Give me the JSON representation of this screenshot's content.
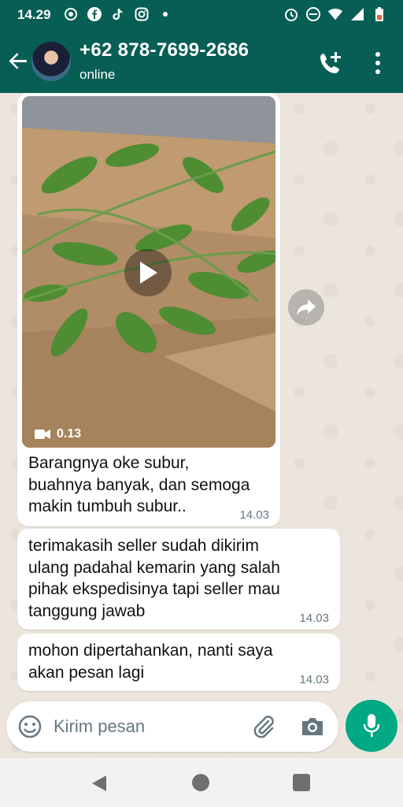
{
  "status_bar": {
    "time": "14.29",
    "left_icons": [
      "whatsapp-status-icon",
      "facebook-icon",
      "tiktok-icon",
      "instagram-icon",
      "dot-icon"
    ],
    "right_icons": [
      "alarm-icon",
      "do-not-disturb-icon",
      "wifi-icon",
      "signal-icon",
      "battery-icon"
    ]
  },
  "header": {
    "contact_name": "+62 878-7699-2686",
    "status": "online"
  },
  "messages": [
    {
      "type": "video",
      "duration": "0.13",
      "caption": "Barangnya oke subur,\nbuahnya banyak, dan semoga\nmakin tumbuh subur..",
      "time": "14.03"
    },
    {
      "type": "text",
      "text": "terimakasih seller sudah dikirim\nulang padahal kemarin yang salah\npihak ekspedisinya tapi seller mau\ntanggung jawab",
      "time": "14.03"
    },
    {
      "type": "text",
      "text": "mohon dipertahankan, nanti saya\nakan pesan lagi",
      "time": "14.03"
    }
  ],
  "composer": {
    "placeholder": "Kirim pesan"
  },
  "colors": {
    "header": "#075e54",
    "accent": "#00a884",
    "wallpaper": "#ece5dd"
  }
}
